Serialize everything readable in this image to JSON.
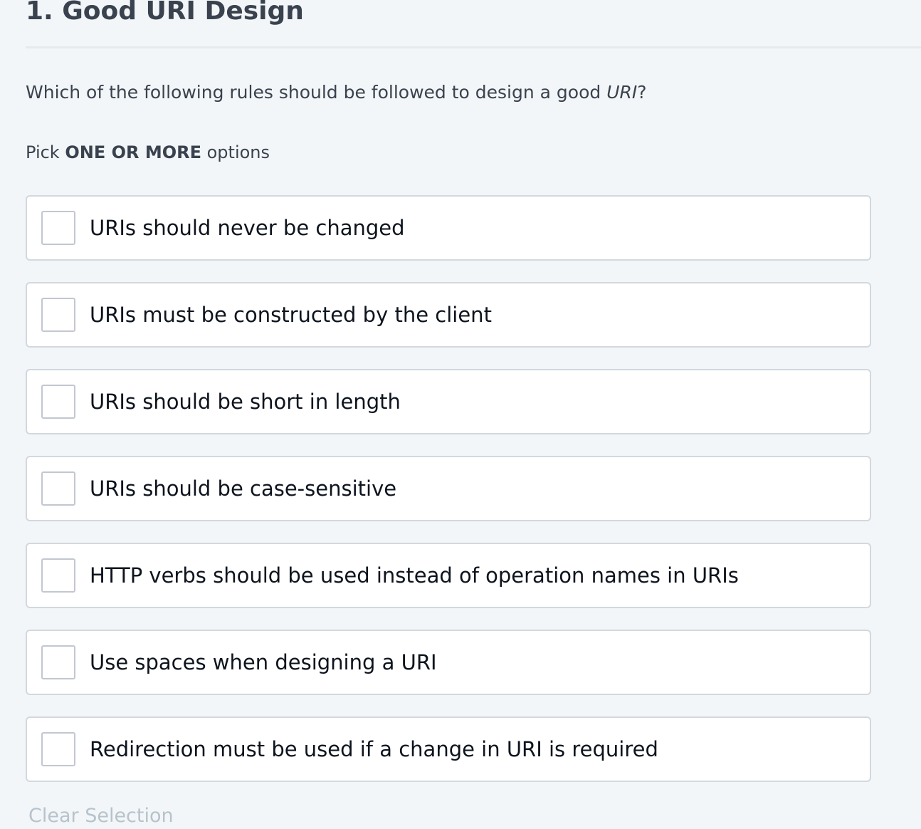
{
  "question": {
    "title": "1. Good URI Design",
    "text_before": "Which of the following rules should be followed to design a good ",
    "text_emphasis": "URI",
    "text_after": "?",
    "instruction_prefix": "Pick ",
    "instruction_strong": "ONE OR MORE",
    "instruction_suffix": " options"
  },
  "options": [
    {
      "label": "URIs should never be changed",
      "checked": false
    },
    {
      "label": "URIs must be constructed by the client",
      "checked": false
    },
    {
      "label": "URIs should be short in length",
      "checked": false
    },
    {
      "label": "URIs should be case-sensitive",
      "checked": false
    },
    {
      "label": "HTTP verbs should be used instead of operation names in URIs",
      "checked": false
    },
    {
      "label": "Use spaces when designing a URI",
      "checked": false
    },
    {
      "label": "Redirection must be used if a change in URI is required",
      "checked": false
    }
  ],
  "actions": {
    "clear_selection_label": "Clear Selection"
  },
  "colors": {
    "background": "#f3f6f8",
    "text_primary": "#39424e",
    "text_option": "#0e141e",
    "border": "#d2d8de",
    "clear_link": "#b7c3cc"
  }
}
